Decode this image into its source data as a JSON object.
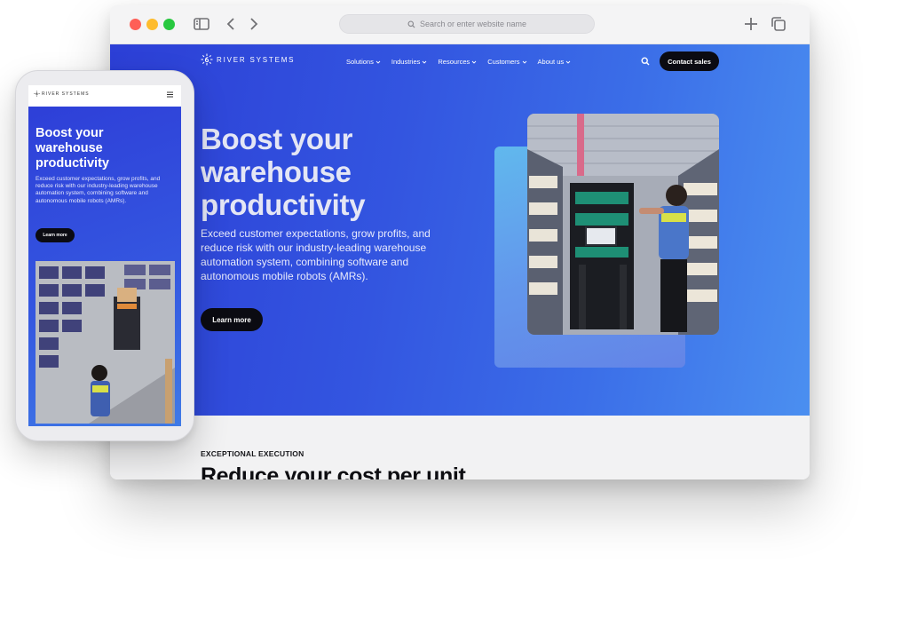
{
  "browser": {
    "address_placeholder": "Search or enter website name",
    "icons": [
      "sidebar-icon",
      "back-arrow-icon",
      "forward-arrow-icon",
      "new-tab-plus-icon",
      "tab-overview-icon"
    ]
  },
  "site": {
    "logo_text": "RIVER SYSTEMS",
    "nav": [
      {
        "label": "Solutions"
      },
      {
        "label": "Industries"
      },
      {
        "label": "Resources"
      },
      {
        "label": "Customers"
      },
      {
        "label": "About us"
      }
    ],
    "contact_label": "Contact sales",
    "hero": {
      "title": "Boost your warehouse productivity",
      "description": "Exceed customer expectations, grow profits, and reduce risk with our industry-leading warehouse automation system, combining software and autonomous mobile robots (AMRs).",
      "cta_label": "Learn more"
    },
    "section": {
      "eyebrow": "EXCEPTIONAL EXECUTION",
      "title": "Reduce your cost per unit"
    }
  },
  "mobile": {
    "logo_text": "RIVER SYSTEMS",
    "title": "Boost your warehouse productivity",
    "description": "Exceed customer expectations, grow profits, and reduce risk with our industry-leading warehouse automation system, combining software and autonomous mobile robots (AMRs).",
    "cta_label": "Learn more"
  },
  "colors": {
    "hero_start": "#2c3fd6",
    "hero_end": "#4b8ff0",
    "button_dark": "#0b0b12",
    "traffic_red": "#fe5f57",
    "traffic_yellow": "#febc2e",
    "traffic_green": "#28c840"
  }
}
